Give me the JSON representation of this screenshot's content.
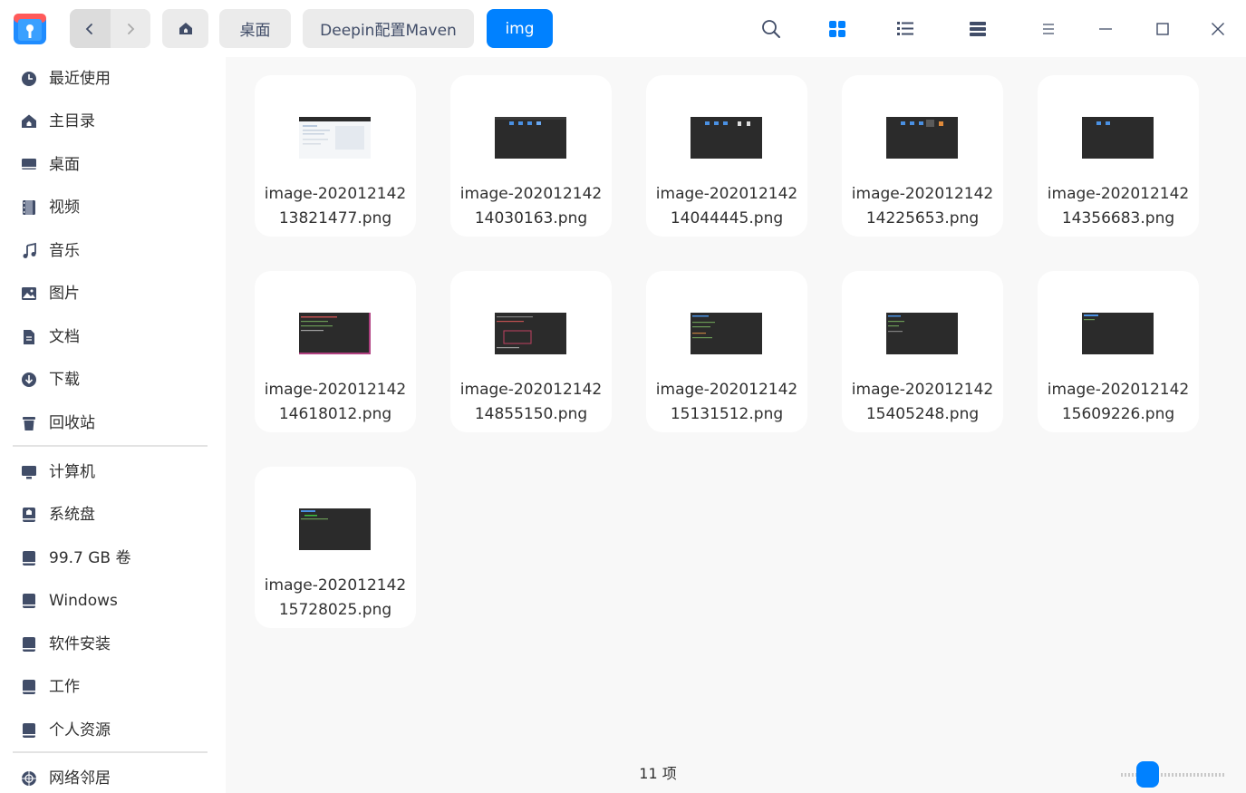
{
  "titlebar": {
    "breadcrumbs": [
      "桌面",
      "Deepin配置Maven",
      "img"
    ],
    "icons": [
      "app-logo-icon",
      "chevron-left-icon",
      "chevron-right-icon",
      "home-icon",
      "search-icon",
      "grid-view-icon",
      "list-view-icon",
      "detail-view-icon",
      "menu-icon",
      "minimize-icon",
      "maximize-icon",
      "close-icon"
    ],
    "accent_color": "#0081ff"
  },
  "sidebar": {
    "items": [
      {
        "label": "最近使用",
        "icon": "clock-icon"
      },
      {
        "label": "主目录",
        "icon": "home-icon"
      },
      {
        "label": "桌面",
        "icon": "desktop-icon"
      },
      {
        "label": "视频",
        "icon": "film-icon"
      },
      {
        "label": "音乐",
        "icon": "music-icon"
      },
      {
        "label": "图片",
        "icon": "picture-icon"
      },
      {
        "label": "文档",
        "icon": "document-icon"
      },
      {
        "label": "下载",
        "icon": "download-icon"
      },
      {
        "label": "回收站",
        "icon": "trash-icon"
      },
      {
        "label": "计算机",
        "icon": "computer-icon"
      },
      {
        "label": "系统盘",
        "icon": "disk-icon"
      },
      {
        "label": "99.7 GB 卷",
        "icon": "disk-icon"
      },
      {
        "label": "Windows",
        "icon": "disk-icon"
      },
      {
        "label": "软件安装",
        "icon": "disk-icon"
      },
      {
        "label": "工作",
        "icon": "disk-icon"
      },
      {
        "label": "个人资源",
        "icon": "disk-icon"
      },
      {
        "label": "网络邻居",
        "icon": "network-icon"
      }
    ]
  },
  "files": [
    {
      "line1": "image-202012142",
      "line2": "13821477.png"
    },
    {
      "line1": "image-202012142",
      "line2": "14030163.png"
    },
    {
      "line1": "image-202012142",
      "line2": "14044445.png"
    },
    {
      "line1": "image-202012142",
      "line2": "14225653.png"
    },
    {
      "line1": "image-202012142",
      "line2": "14356683.png"
    },
    {
      "line1": "image-202012142",
      "line2": "14618012.png"
    },
    {
      "line1": "image-202012142",
      "line2": "14855150.png"
    },
    {
      "line1": "image-202012142",
      "line2": "15131512.png"
    },
    {
      "line1": "image-202012142",
      "line2": "15405248.png"
    },
    {
      "line1": "image-202012142",
      "line2": "15609226.png"
    },
    {
      "line1": "image-202012142",
      "line2": "15728025.png"
    }
  ],
  "status": {
    "item_count": "11 项",
    "zoom_level": 0.2
  }
}
